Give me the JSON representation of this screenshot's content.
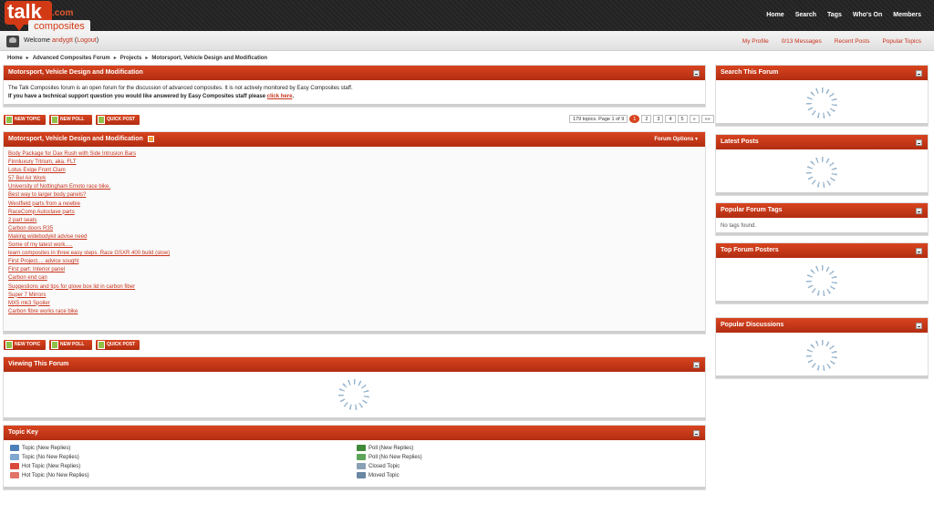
{
  "header": {
    "logo_talk": "talk",
    "logo_com": ".com",
    "logo_composites": "composites",
    "nav": [
      "Home",
      "Search",
      "Tags",
      "Who's On",
      "Members"
    ]
  },
  "userbar": {
    "welcome": "Welcome",
    "username": "andygtt",
    "logout_open": "(",
    "logout": "Logout",
    "logout_close": ")",
    "links": [
      "My Profile",
      "0/13 Messages",
      "Recent Posts",
      "Popular Topics"
    ]
  },
  "breadcrumb": [
    "Home",
    "Advanced Composites Forum",
    "Projects",
    "Motorsport, Vehicle Design and Modification"
  ],
  "info_panel": {
    "title": "Motorsport, Vehicle Design and Modification",
    "line1": "The Talk Composites forum is an open forum for the discussion of advanced composites. It is not actively monitored by Easy Composites staff.",
    "line2": "If you have a technical support question you would like answered by Easy Composites staff please",
    "line2_link": "click here",
    "line2_end": "."
  },
  "buttons": {
    "new_topic": "NEW TOPIC",
    "new_poll": "NEW POLL",
    "quick_post": "QUICK POST"
  },
  "pager": {
    "summary": "179 topics. Page 1 of 9",
    "pages": [
      "1",
      "2",
      "3",
      "4",
      "5",
      "»",
      "»»"
    ]
  },
  "topic_panel": {
    "title": "Motorsport, Vehicle Design and Modification",
    "options": "Forum Options",
    "topics": [
      "Body Package for Dax Rush with Side Intrusion Bars",
      "Finnluxury Trtrium, aka. FLT",
      "Lotus Exige Front Clam",
      "57 Bel Air Work",
      "University of Nottingham Emoto race bike.",
      "Best way to larger body panels?",
      "Westfield parts from a newbie",
      "RaceComp Autoclave parts",
      "2 part seats",
      "Carbon doors R35",
      "Making widebodykit advise need",
      "Some of my latest work.....",
      "learn composites in three easy steps. Race GSXR 400 build (slow)",
      "First Project.... advice sought",
      "First part: Interior panel",
      "Carbon end can",
      "Suggestions and tips for glove box lid in carbon fiber",
      "Super 7 Mirrors",
      "MX5 mk3 Spoiler",
      "Carbon fibre works race bike"
    ]
  },
  "viewing_panel": {
    "title": "Viewing This Forum"
  },
  "topic_key": {
    "title": "Topic Key",
    "left": [
      "Topic (New Replies)",
      "Topic (No New Replies)",
      "Hot Topic (New Replies)",
      "Hot Topic (No New Replies)"
    ],
    "right": [
      "Poll (New Replies)",
      "Poll (No New Replies)",
      "Closed Topic",
      "Moved Topic"
    ]
  },
  "sidebar": {
    "search_title": "Search This Forum",
    "latest_title": "Latest Posts",
    "tags_title": "Popular Forum Tags",
    "tags_empty": "No tags found.",
    "posters_title": "Top Forum Posters",
    "discussions_title": "Popular Discussions"
  },
  "colors": {
    "accent": "#c8331c",
    "header_bg": "#222222"
  }
}
